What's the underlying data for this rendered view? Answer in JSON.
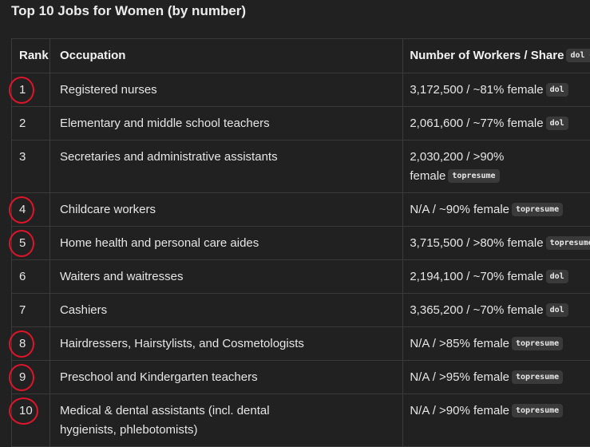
{
  "title": "Top 10 Jobs for Women (by number)",
  "headers": {
    "rank": "Rank",
    "occupation": "Occupation",
    "number": "Number of Workers / Share",
    "number_tag": "dol +"
  },
  "rows": [
    {
      "rank": "1",
      "occupation": "Registered nurses",
      "number": "3,172,500 / ~81% female",
      "number_line2": "",
      "source": "dol",
      "circled": true
    },
    {
      "rank": "2",
      "occupation": "Elementary and middle school teachers",
      "number": "2,061,600 / ~77% female",
      "number_line2": "",
      "source": "dol",
      "circled": false
    },
    {
      "rank": "3",
      "occupation": "Secretaries and administrative assistants",
      "number": "2,030,200 / >90%",
      "number_line2": "female",
      "source": "topresume",
      "circled": false
    },
    {
      "rank": "4",
      "occupation": "Childcare workers",
      "number": "N/A / ~90% female",
      "number_line2": "",
      "source": "topresume",
      "circled": true
    },
    {
      "rank": "5",
      "occupation": "Home health and personal care aides",
      "number": "3,715,500 / >80% female",
      "number_line2": "",
      "source": "topresume",
      "circled": true
    },
    {
      "rank": "6",
      "occupation": "Waiters and waitresses",
      "number": "2,194,100 / ~70% female",
      "number_line2": "",
      "source": "dol",
      "circled": false
    },
    {
      "rank": "7",
      "occupation": "Cashiers",
      "number": "3,365,200 / ~70% female",
      "number_line2": "",
      "source": "dol",
      "circled": false
    },
    {
      "rank": "8",
      "occupation": "Hairdressers, Hairstylists, and Cosmetologists",
      "number": "N/A / >85% female",
      "number_line2": "",
      "source": "topresume",
      "circled": true
    },
    {
      "rank": "9",
      "occupation": "Preschool and Kindergarten teachers",
      "number": "N/A / >95% female",
      "number_line2": "",
      "source": "topresume",
      "circled": true
    },
    {
      "rank": "10",
      "occupation": "Medical & dental assistants (incl. dental",
      "occupation_line2": "hygienists, phlebotomists)",
      "number": "N/A / >90% female",
      "number_line2": "",
      "source": "topresume",
      "circled": true
    }
  ],
  "colors": {
    "background": "#212121",
    "circle": "#e0142a",
    "tag_bg": "#3a3a3a"
  }
}
